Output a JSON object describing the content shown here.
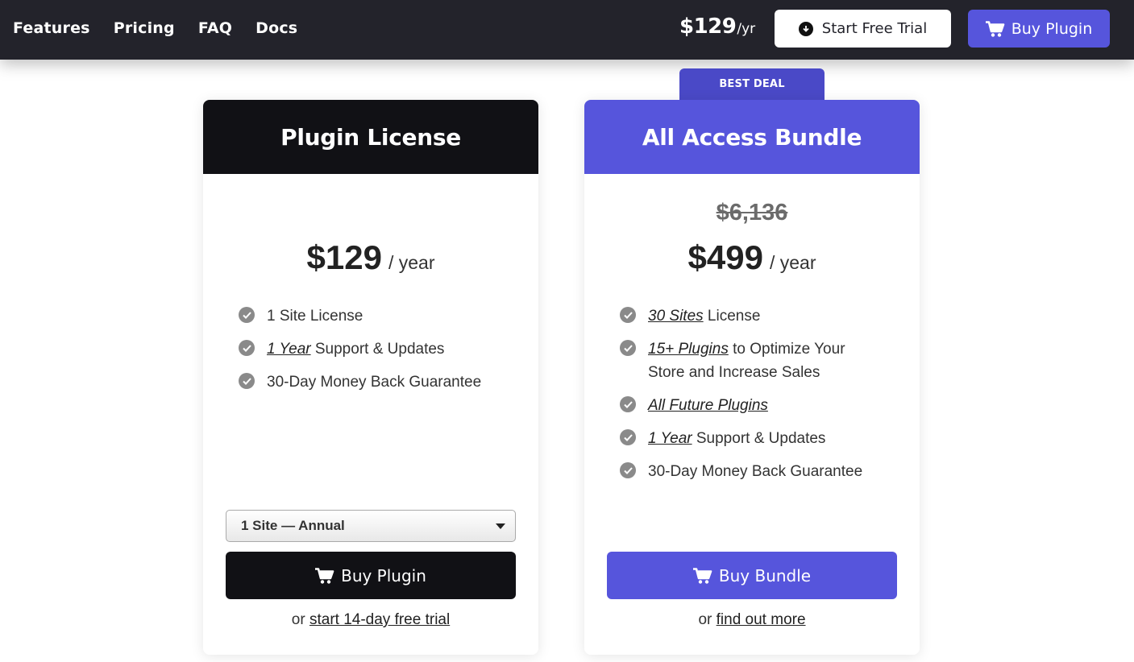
{
  "nav": {
    "items": [
      "Features",
      "Pricing",
      "FAQ",
      "Docs"
    ]
  },
  "header": {
    "price": "$129",
    "price_period": "/yr",
    "trial_label": "Start Free Trial",
    "buy_label": "Buy Plugin"
  },
  "badge": {
    "label": "BEST DEAL"
  },
  "plans": [
    {
      "title": "Plugin License",
      "price": "$129",
      "period": "/ year",
      "features": [
        {
          "em": "",
          "text": "1 Site License"
        },
        {
          "em": "1 Year",
          "text": " Support & Updates"
        },
        {
          "em": "",
          "text": "30-Day Money Back Guarantee"
        }
      ],
      "select_value": "1 Site — Annual",
      "cta": "Buy Plugin",
      "sub_prefix": "or ",
      "sub_link": "start 14-day free trial"
    },
    {
      "title": "All Access Bundle",
      "old_price": "$6,136",
      "price": "$499",
      "period": "/ year",
      "features": [
        {
          "em": "30 Sites",
          "text": " License"
        },
        {
          "em": "15+ Plugins",
          "text": " to Optimize Your Store and Increase Sales"
        },
        {
          "em": "All Future Plugins",
          "text": ""
        },
        {
          "em": "1 Year",
          "text": " Support & Updates"
        },
        {
          "em": "",
          "text": "30-Day Money Back Guarantee"
        }
      ],
      "cta": "Buy Bundle",
      "sub_prefix": "or ",
      "sub_link": "find out more"
    }
  ],
  "colors": {
    "topbar": "#23232b",
    "accent": "#5655dc",
    "dark": "#111115",
    "check": "#8a8a8a"
  },
  "icons": [
    "download-icon",
    "cart-icon",
    "check-circle-icon",
    "chevron-down-icon"
  ]
}
